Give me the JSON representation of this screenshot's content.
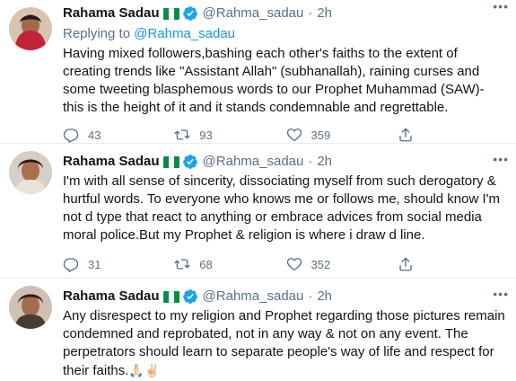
{
  "colors": {
    "accent": "#1b95e0",
    "muted": "#5b7083",
    "text": "#0f1419",
    "verified": "#1da1f2"
  },
  "tweets": [
    {
      "name": "Rahama Sadau",
      "handle": "@Rahma_sadau",
      "time": "2h",
      "reply_prefix": "Replying to ",
      "reply_handle": "@Rahma_sadau",
      "text": "Having mixed followers,bashing each other's faiths to the extent of creating trends like \"Assistant Allah\" (subhanallah), raining curses and some tweeting blasphemous words to our Prophet Muhammad (SAW)- this is the height of it and it stands condemnable and regrettable.",
      "replies": "43",
      "retweets": "93",
      "likes": "359"
    },
    {
      "name": "Rahama Sadau",
      "handle": "@Rahma_sadau",
      "time": "2h",
      "text": "I'm with all sense of sincerity, dissociating myself from such derogatory & hurtful words. To everyone who knows me or follows me, should know I'm not d type that react to anything or embrace advices from social media moral police.But my Prophet & religion is where i draw d line.",
      "replies": "31",
      "retweets": "68",
      "likes": "352"
    },
    {
      "name": "Rahama Sadau",
      "handle": "@Rahma_sadau",
      "time": "2h",
      "text": "Any disrespect to my religion and Prophet regarding those pictures remain condemned and reprobated, not in any way & not on any event. The perpetrators should  learn to separate people's way of life and respect for their faiths.",
      "emoji": "🙏🏻✌🏻"
    }
  ]
}
